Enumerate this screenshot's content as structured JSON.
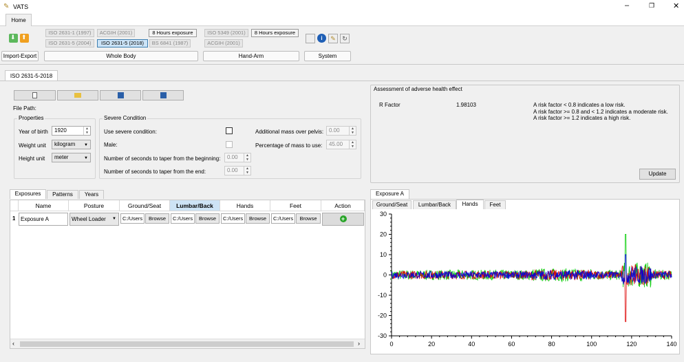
{
  "app": {
    "title": "VATS"
  },
  "ribbon": {
    "home_tab": "Home",
    "standards": {
      "iso2631_1": "ISO 2631-1 (1997)",
      "acgih_wb": "ACGIH (2001)",
      "hours_wb": "8 Hours exposure",
      "iso2631_5_2004": "ISO 2631-5 (2004)",
      "iso2631_5_2018": "ISO 2631-5 (2018)",
      "bs6841": "BS 6841 (1987)",
      "iso5349": "ISO 5349 (2001)",
      "hours_ha": "8 Hours exposure",
      "acgih_ha": "ACGIH (2001)"
    },
    "groups": {
      "import_export": "Import-Export",
      "whole_body": "Whole Body",
      "hand_arm": "Hand-Arm",
      "system": "System"
    }
  },
  "doc_tab": "ISO 2631-5-2018",
  "form": {
    "file_path_label": "File Path:",
    "properties": {
      "title": "Properties",
      "year_label": "Year of birth",
      "year_value": "1920",
      "weight_label": "Weight unit",
      "weight_value": "kilogram",
      "height_label": "Height unit",
      "height_value": "meter"
    },
    "severe": {
      "title": "Severe Condition",
      "use_label": "Use severe condition:",
      "male_label": "Male:",
      "taper_begin_label": "Number of seconds to taper from the beginning:",
      "taper_begin_value": "0.00",
      "taper_end_label": "Number of seconds to taper from the end:",
      "taper_end_value": "0.00",
      "mass_label": "Additional mass over pelvis:",
      "mass_value": "0.00",
      "pct_label": "Percentage of mass to use:",
      "pct_value": "45.00"
    }
  },
  "assessment": {
    "title": "Assessment of adverse health effect",
    "rfactor_label": "R Factor",
    "rfactor_value": "1.98103",
    "notes": [
      "A risk factor < 0.8 indicates a low risk.",
      "A risk factor >= 0.8 and < 1.2 indicates a moderate risk.",
      "A risk factor >= 1.2 indicates a high risk."
    ],
    "update_button": "Update"
  },
  "exposures": {
    "tabs": [
      "Exposures",
      "Patterns",
      "Years"
    ],
    "columns": [
      "Name",
      "Posture",
      "Ground/Seat",
      "Lumbar/Back",
      "Hands",
      "Feet",
      "Action"
    ],
    "rows": [
      {
        "index": "1",
        "name": "Exposure A",
        "posture": "Wheel Loader",
        "ground": "C:/Users",
        "lumbar": "C:/Users",
        "hands": "C:/Users",
        "feet": "C:/Users",
        "browse": "Browse"
      }
    ]
  },
  "plot": {
    "outer_tab": "Exposure A",
    "tabs": [
      "Ground/Seat",
      "Lumbar/Back",
      "Hands",
      "Feet"
    ],
    "active_tab": "Hands"
  },
  "chart_data": {
    "type": "line",
    "title": "",
    "xlabel": "",
    "ylabel": "",
    "xlim": [
      0,
      140
    ],
    "ylim": [
      -30,
      30
    ],
    "xticks": [
      0,
      20,
      40,
      60,
      80,
      100,
      120,
      140
    ],
    "yticks": [
      30,
      20,
      10,
      0,
      -10,
      -20,
      -30
    ],
    "x_range_of_signal": [
      0,
      140
    ],
    "series": [
      {
        "color": "#00cc00",
        "baseline": 0,
        "amplitude": 2.5,
        "spike": {
          "x": 117,
          "value": 20
        }
      },
      {
        "color": "#dd0000",
        "baseline": 0,
        "amplitude": 2,
        "spike": {
          "x": 117,
          "value": -23
        }
      },
      {
        "color": "#0000dd",
        "baseline": 0,
        "amplitude": 1.8,
        "spike": {
          "x": 117,
          "value": 10
        }
      }
    ]
  }
}
